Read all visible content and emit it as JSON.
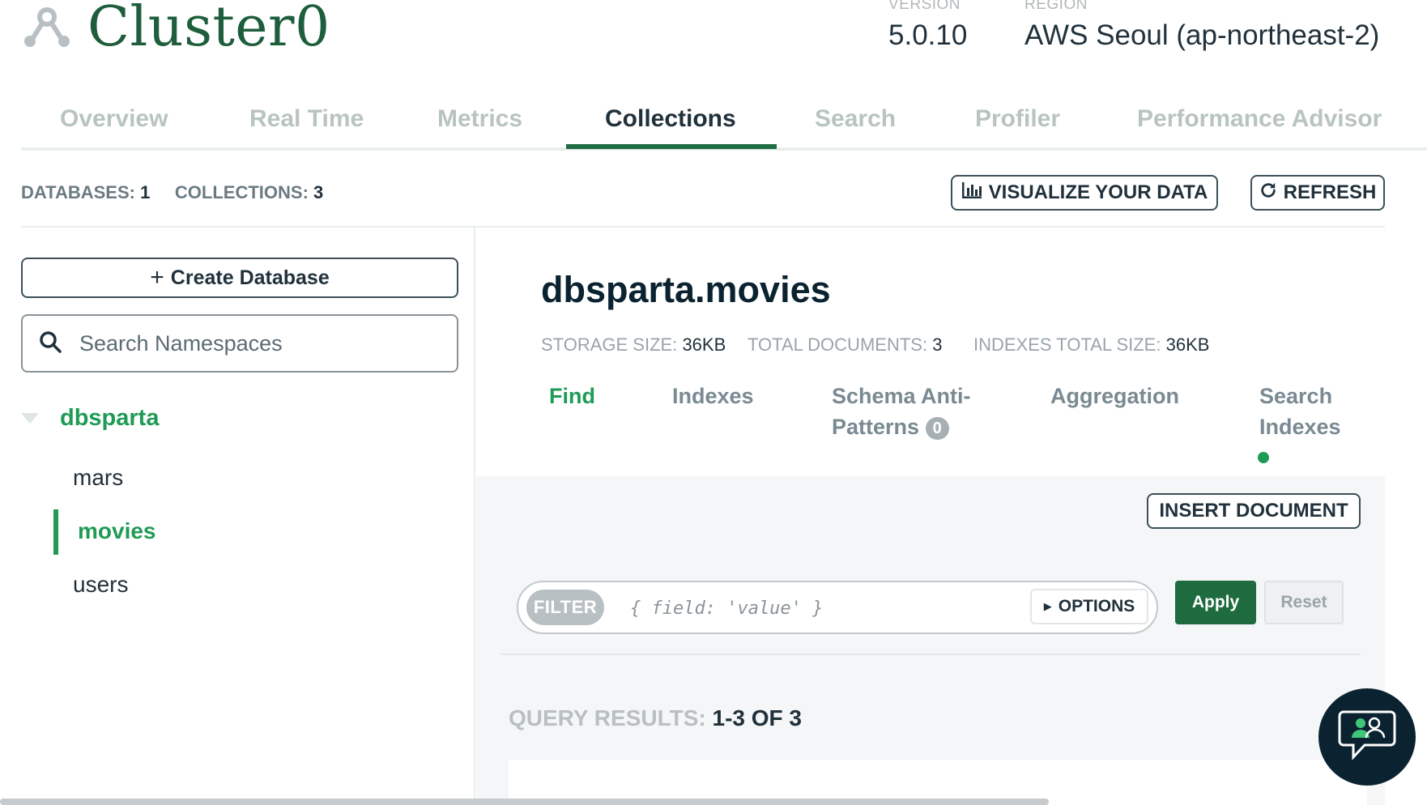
{
  "header": {
    "cluster_name": "Cluster0",
    "version_label": "VERSION",
    "version_value": "5.0.10",
    "region_label": "REGION",
    "region_value": "AWS Seoul (ap-northeast-2)"
  },
  "tabs": [
    {
      "label": "Overview"
    },
    {
      "label": "Real Time"
    },
    {
      "label": "Metrics"
    },
    {
      "label": "Collections",
      "active": true
    },
    {
      "label": "Search"
    },
    {
      "label": "Profiler"
    },
    {
      "label": "Performance Advisor"
    }
  ],
  "stats": {
    "databases_label": "DATABASES:",
    "databases_value": "1",
    "collections_label": "COLLECTIONS:",
    "collections_value": "3"
  },
  "actions": {
    "visualize_label": "VISUALIZE YOUR DATA",
    "refresh_label": "REFRESH"
  },
  "sidebar": {
    "create_db_label": "Create Database",
    "search_placeholder": "Search Namespaces",
    "database": "dbsparta",
    "collections": [
      "mars",
      "movies",
      "users"
    ],
    "active_collection": "movies"
  },
  "namespace": {
    "title": "dbsparta.movies",
    "storage_label": "STORAGE SIZE:",
    "storage_value": "36KB",
    "documents_label": "TOTAL DOCUMENTS:",
    "documents_value": "3",
    "indexes_label": "INDEXES TOTAL SIZE:",
    "indexes_value": "36KB"
  },
  "subtabs": {
    "find": "Find",
    "indexes": "Indexes",
    "schema_line1": "Schema Anti-",
    "schema_line2": "Patterns",
    "schema_badge": "0",
    "aggregation": "Aggregation",
    "search_line1": "Search",
    "search_line2": "Indexes"
  },
  "find": {
    "insert_label": "INSERT DOCUMENT",
    "filter_label": "FILTER",
    "filter_placeholder": "{ field: 'value' }",
    "options_label": "OPTIONS",
    "apply_label": "Apply",
    "reset_label": "Reset",
    "results_label": "QUERY RESULTS:",
    "results_value": "1-3 OF 3"
  },
  "colors": {
    "brand_green": "#1f9b55",
    "dark_green": "#1e6b3f",
    "title_green": "#1e5e3c",
    "navy": "#0b2330"
  },
  "icons": {
    "cluster": "cluster-icon",
    "search": "search-icon",
    "visualize": "bar-chart-icon",
    "refresh": "refresh-icon",
    "chat": "chat-support-icon"
  }
}
